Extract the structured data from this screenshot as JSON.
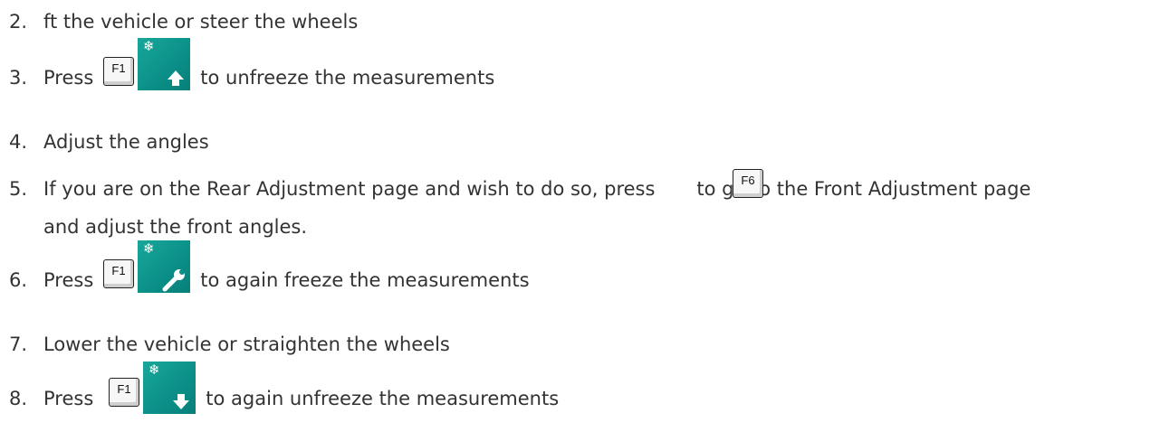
{
  "steps": [
    {
      "num": "2.",
      "text": "ft the vehicle or steer the wheels"
    },
    {
      "num": "3.",
      "pre": "Press",
      "post": "to unfreeze the measurements",
      "key": "F1",
      "icon": "snowflake-up-arrow-icon"
    },
    {
      "num": "4.",
      "text": "Adjust the angles"
    },
    {
      "num": "5.",
      "pre": "If you are on the Rear Adjustment page and wish to do so, press",
      "post": "to go to the Front Adjustment page",
      "key": "F6",
      "cont": "and adjust the front angles."
    },
    {
      "num": "6.",
      "pre": "Press",
      "post": "to again freeze the measurements",
      "key": "F1",
      "icon": "snowflake-wrench-icon"
    },
    {
      "num": "7.",
      "text": "Lower the vehicle or straighten the wheels"
    },
    {
      "num": "8.",
      "pre": "Press",
      "post": "to again unfreeze the measurements",
      "key": "F1",
      "icon": "snowflake-down-arrow-icon"
    }
  ],
  "colors": {
    "text": "#333333",
    "tile": "#0b8f88",
    "icon_glyph": "#ffffff"
  }
}
